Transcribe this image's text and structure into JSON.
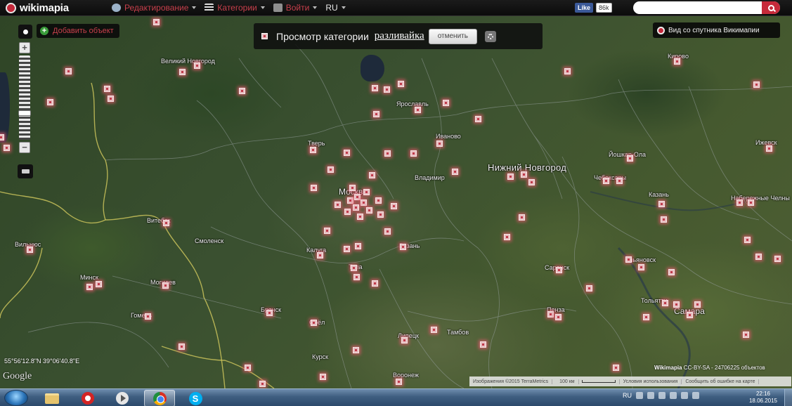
{
  "topbar": {
    "logo_text": "wikimapia",
    "menu": [
      {
        "label": "Редактирование",
        "icon": "globe-icon"
      },
      {
        "label": "Категории",
        "icon": "categories-icon"
      },
      {
        "label": "Войти",
        "icon": "login-icon"
      },
      {
        "label": "RU",
        "icon": "language-caret"
      }
    ],
    "fb_like": "Like",
    "fb_count": "86k",
    "search": {
      "value": "",
      "placeholder": ""
    }
  },
  "map": {
    "add_object": "Добавить объект",
    "category_view": {
      "title": "Просмотр категории",
      "link": "разливайка",
      "cancel": "отменить"
    },
    "satellite_view": "Вид со спутника Викимапии",
    "cities": [
      {
        "name": "Великий Новгород",
        "cls": ""
      },
      {
        "name": "Ярославль",
        "cls": ""
      },
      {
        "name": "Иваново",
        "cls": ""
      },
      {
        "name": "Тверь",
        "cls": ""
      },
      {
        "name": "Нижний Новгород",
        "cls": "big"
      },
      {
        "name": "Владимир",
        "cls": ""
      },
      {
        "name": "Йошкар-Ола",
        "cls": ""
      },
      {
        "name": "Чебоксары",
        "cls": ""
      },
      {
        "name": "Ижевск",
        "cls": ""
      },
      {
        "name": "Казань",
        "cls": ""
      },
      {
        "name": "Набережные Челны",
        "cls": ""
      },
      {
        "name": "Кирово",
        "cls": ""
      },
      {
        "name": "Витебск",
        "cls": ""
      },
      {
        "name": "Смоленск",
        "cls": ""
      },
      {
        "name": "Вильнюс",
        "cls": ""
      },
      {
        "name": "Минск",
        "cls": ""
      },
      {
        "name": "Могилев",
        "cls": ""
      },
      {
        "name": "Калуга",
        "cls": ""
      },
      {
        "name": "Тула",
        "cls": ""
      },
      {
        "name": "Рязань",
        "cls": ""
      },
      {
        "name": "Брянск",
        "cls": ""
      },
      {
        "name": "Гомель",
        "cls": ""
      },
      {
        "name": "Орёл",
        "cls": ""
      },
      {
        "name": "Липецк",
        "cls": ""
      },
      {
        "name": "Тамбов",
        "cls": ""
      },
      {
        "name": "Саранск",
        "cls": ""
      },
      {
        "name": "Ульяновск",
        "cls": ""
      },
      {
        "name": "Пенза",
        "cls": ""
      },
      {
        "name": "Самара",
        "cls": "large"
      },
      {
        "name": "Курск",
        "cls": ""
      },
      {
        "name": "Воронеж",
        "cls": ""
      },
      {
        "name": "Тольятти",
        "cls": ""
      },
      {
        "name": "Москва",
        "cls": "large"
      }
    ],
    "coords": "55°56'12.8\"N 39°06'40.8\"E",
    "google": "Google",
    "copyright_brand": "Wikimapia",
    "copyright_rest": " CC-BY-SA - 24706225 объектов",
    "bottom_strip": [
      "Изображения ©2015 TerraMetrics",
      "100 км",
      "Условия использования",
      "Сообщить об ошибке на карте"
    ]
  },
  "taskbar": {
    "language": "RU",
    "time": "22:16",
    "date": "18.06.2015"
  },
  "colors": {
    "pin_glow": "#e65a6e",
    "accent": "#c62a3a",
    "taskbar": "#3f5e80"
  }
}
